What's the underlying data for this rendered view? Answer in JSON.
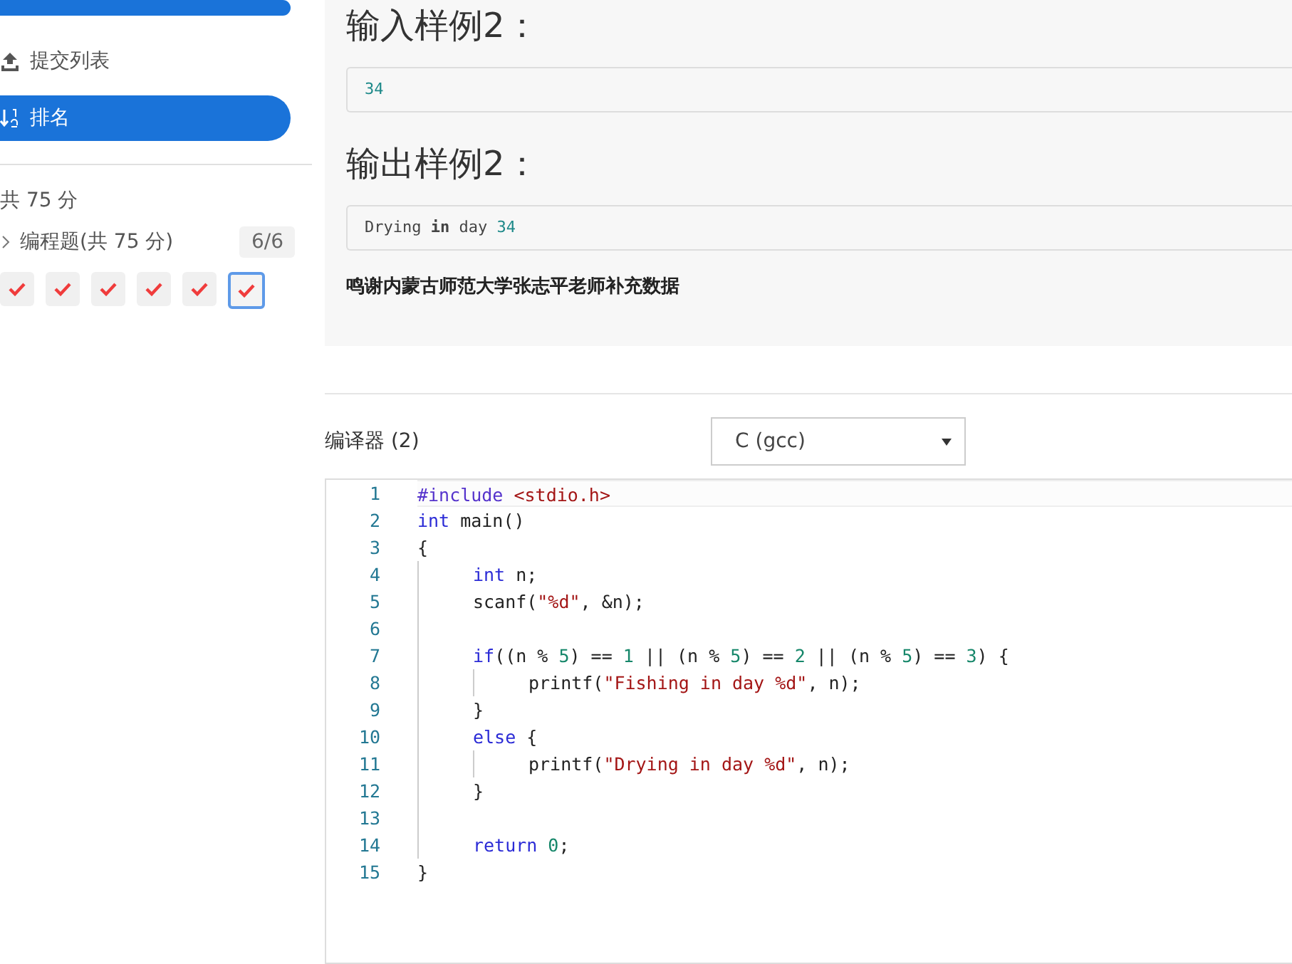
{
  "sidebar": {
    "nav_items": [
      {
        "kind": "cut",
        "selected": true
      },
      {
        "label": "提交列表",
        "kind": "upload",
        "selected": false
      },
      {
        "label": "排名",
        "kind": "sort",
        "selected": true
      }
    ],
    "total_score": "共 75 分",
    "section": {
      "label": "编程题(共 75 分)",
      "count": "6/6",
      "expanded": false
    },
    "problems": [
      {
        "solved": true,
        "selected": false
      },
      {
        "solved": true,
        "selected": false
      },
      {
        "solved": true,
        "selected": false
      },
      {
        "solved": true,
        "selected": false
      },
      {
        "solved": true,
        "selected": false
      },
      {
        "solved": true,
        "selected": true
      }
    ]
  },
  "samples": [
    {
      "heading": "输入样例2：",
      "tokens": [
        {
          "text": "34",
          "kind": "number"
        }
      ]
    },
    {
      "heading": "输出样例2：",
      "tokens": [
        {
          "text": "Drying ",
          "kind": "plain"
        },
        {
          "text": "in",
          "kind": "bold"
        },
        {
          "text": " day ",
          "kind": "plain"
        },
        {
          "text": "34",
          "kind": "number"
        }
      ]
    }
  ],
  "note": "鸣谢内蒙古师范大学张志平老师补充数据",
  "compiler": {
    "label": "编译器 (2)",
    "value": "C (gcc)"
  },
  "editor": {
    "lines": [
      {
        "number": "1",
        "current": true,
        "tokens": [
          {
            "text": "#include",
            "kind": "meta"
          },
          {
            "text": " <stdio.h>",
            "kind": "string"
          }
        ]
      },
      {
        "number": "2",
        "current": false,
        "tokens": [
          {
            "text": "int",
            "kind": "keyword"
          },
          {
            "text": " main()",
            "kind": "plain"
          }
        ]
      },
      {
        "number": "3",
        "current": false,
        "tokens": [
          {
            "text": "{",
            "kind": "plain"
          }
        ]
      },
      {
        "number": "4",
        "current": false,
        "tokens": [
          {
            "text": "    int",
            "kind": "keyword"
          },
          {
            "text": " n;",
            "kind": "plain"
          }
        ]
      },
      {
        "number": "5",
        "current": false,
        "tokens": [
          {
            "text": "    scanf(",
            "kind": "plain"
          },
          {
            "text": "\"%d\"",
            "kind": "string"
          },
          {
            "text": ", &n);",
            "kind": "plain"
          }
        ]
      },
      {
        "number": "6",
        "current": false
      },
      {
        "number": "7",
        "current": false,
        "tokens": [
          {
            "text": "    if",
            "kind": "keyword"
          },
          {
            "text": "((n % ",
            "kind": "plain"
          },
          {
            "text": "5",
            "kind": "number"
          },
          {
            "text": ") == ",
            "kind": "plain"
          },
          {
            "text": "1",
            "kind": "number"
          },
          {
            "text": " || (n % ",
            "kind": "plain"
          },
          {
            "text": "5",
            "kind": "number"
          },
          {
            "text": ") == ",
            "kind": "plain"
          },
          {
            "text": "2",
            "kind": "number"
          },
          {
            "text": " || (n % ",
            "kind": "plain"
          },
          {
            "text": "5",
            "kind": "number"
          },
          {
            "text": ") == ",
            "kind": "plain"
          },
          {
            "text": "3",
            "kind": "number"
          },
          {
            "text": ") {",
            "kind": "plain"
          }
        ]
      },
      {
        "number": "8",
        "current": false,
        "tokens": [
          {
            "text": "        printf(",
            "kind": "plain"
          },
          {
            "text": "\"Fishing in day %d\"",
            "kind": "string"
          },
          {
            "text": ", n);",
            "kind": "plain"
          }
        ]
      },
      {
        "number": "9",
        "current": false,
        "tokens": [
          {
            "text": "    }",
            "kind": "plain"
          }
        ]
      },
      {
        "number": "10",
        "current": false,
        "tokens": [
          {
            "text": "    else",
            "kind": "keyword"
          },
          {
            "text": " {",
            "kind": "plain"
          }
        ]
      },
      {
        "number": "11",
        "current": false,
        "tokens": [
          {
            "text": "        printf(",
            "kind": "plain"
          },
          {
            "text": "\"Drying in day %d\"",
            "kind": "string"
          },
          {
            "text": ", n);",
            "kind": "plain"
          }
        ]
      },
      {
        "number": "12",
        "current": false,
        "tokens": [
          {
            "text": "    }",
            "kind": "plain"
          }
        ]
      },
      {
        "number": "13",
        "current": false
      },
      {
        "number": "14",
        "current": false,
        "tokens": [
          {
            "text": "    return",
            "kind": "keyword"
          },
          {
            "text": " 0",
            "kind": "number"
          },
          {
            "text": ";",
            "kind": "plain"
          }
        ]
      },
      {
        "number": "15",
        "current": false,
        "tokens": [
          {
            "text": "}",
            "kind": "plain"
          }
        ]
      }
    ]
  }
}
